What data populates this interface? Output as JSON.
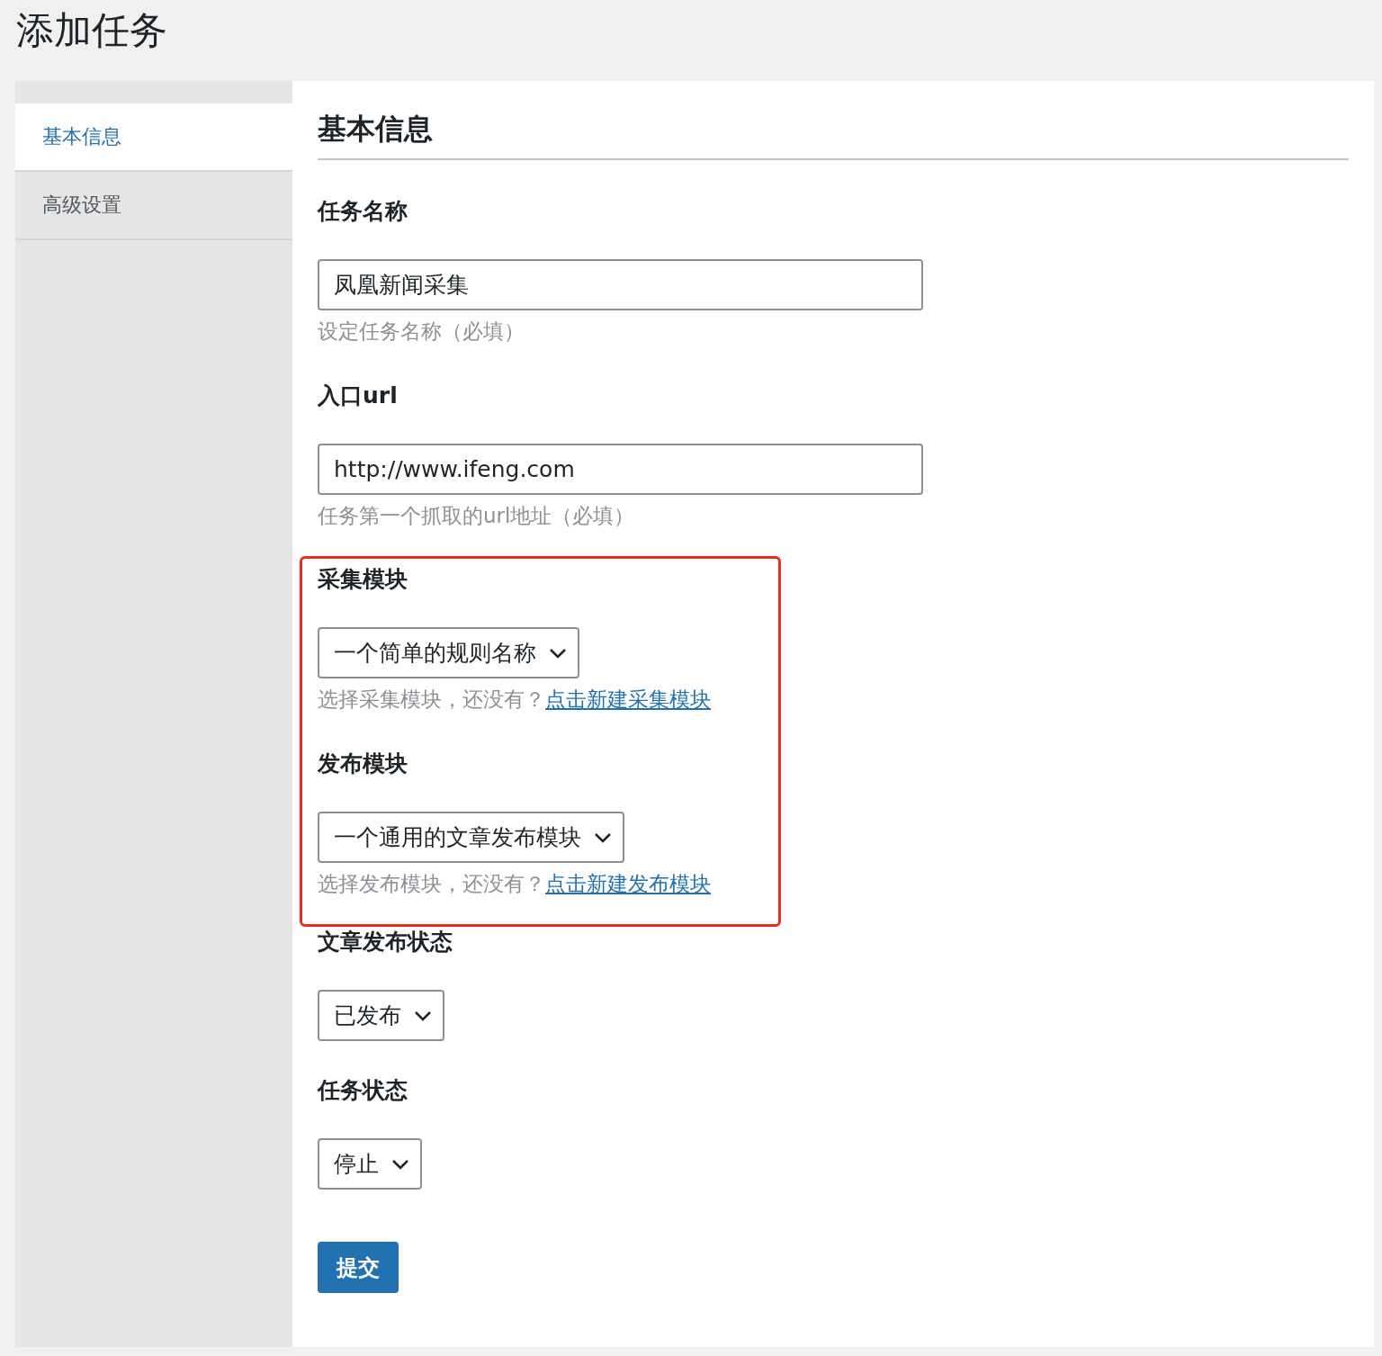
{
  "page_title": "添加任务",
  "sidebar": {
    "items": [
      {
        "label": "基本信息",
        "selected": true
      },
      {
        "label": "高级设置",
        "selected": false
      }
    ]
  },
  "section_title": "基本信息",
  "fields": [
    {
      "kind": "text",
      "label": "任务名称",
      "value": "凤凰新闻采集",
      "hint": "设定任务名称（必填）",
      "highlighted": false
    },
    {
      "kind": "text",
      "label": "入口url",
      "value": "http://www.ifeng.com",
      "hint": "任务第一个抓取的url地址（必填）",
      "highlighted": false
    },
    {
      "kind": "select",
      "label": "采集模块",
      "value": "一个简单的规则名称",
      "hint": "选择采集模块，还没有？",
      "link": "点击新建采集模块",
      "highlighted": true
    },
    {
      "kind": "select",
      "label": "发布模块",
      "value": "一个通用的文章发布模块",
      "hint": "选择发布模块，还没有？",
      "link": "点击新建发布模块",
      "highlighted": true
    },
    {
      "kind": "select",
      "label": "文章发布状态",
      "value": "已发布",
      "highlighted": false
    },
    {
      "kind": "select",
      "label": "任务状态",
      "value": "停止",
      "highlighted": false
    }
  ],
  "submit_button": "提交"
}
